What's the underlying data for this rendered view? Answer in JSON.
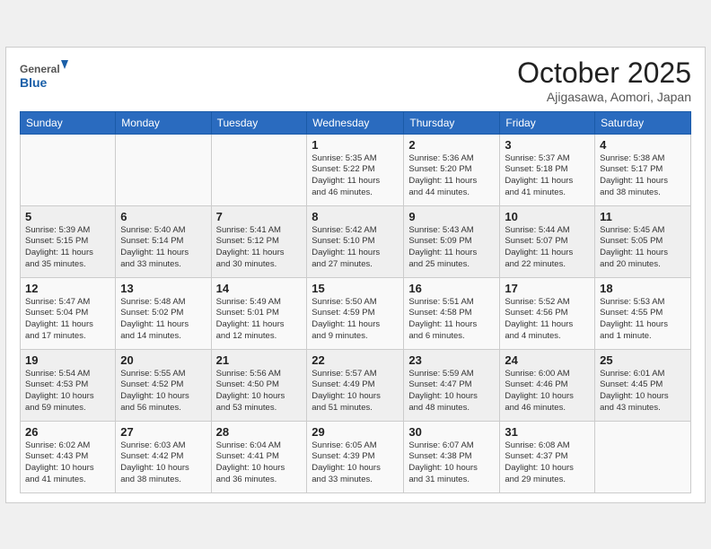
{
  "header": {
    "logo_line1": "General",
    "logo_line2": "Blue",
    "month": "October 2025",
    "location": "Ajigasawa, Aomori, Japan"
  },
  "weekdays": [
    "Sunday",
    "Monday",
    "Tuesday",
    "Wednesday",
    "Thursday",
    "Friday",
    "Saturday"
  ],
  "weeks": [
    [
      {
        "num": "",
        "info": ""
      },
      {
        "num": "",
        "info": ""
      },
      {
        "num": "",
        "info": ""
      },
      {
        "num": "1",
        "info": "Sunrise: 5:35 AM\nSunset: 5:22 PM\nDaylight: 11 hours\nand 46 minutes."
      },
      {
        "num": "2",
        "info": "Sunrise: 5:36 AM\nSunset: 5:20 PM\nDaylight: 11 hours\nand 44 minutes."
      },
      {
        "num": "3",
        "info": "Sunrise: 5:37 AM\nSunset: 5:18 PM\nDaylight: 11 hours\nand 41 minutes."
      },
      {
        "num": "4",
        "info": "Sunrise: 5:38 AM\nSunset: 5:17 PM\nDaylight: 11 hours\nand 38 minutes."
      }
    ],
    [
      {
        "num": "5",
        "info": "Sunrise: 5:39 AM\nSunset: 5:15 PM\nDaylight: 11 hours\nand 35 minutes."
      },
      {
        "num": "6",
        "info": "Sunrise: 5:40 AM\nSunset: 5:14 PM\nDaylight: 11 hours\nand 33 minutes."
      },
      {
        "num": "7",
        "info": "Sunrise: 5:41 AM\nSunset: 5:12 PM\nDaylight: 11 hours\nand 30 minutes."
      },
      {
        "num": "8",
        "info": "Sunrise: 5:42 AM\nSunset: 5:10 PM\nDaylight: 11 hours\nand 27 minutes."
      },
      {
        "num": "9",
        "info": "Sunrise: 5:43 AM\nSunset: 5:09 PM\nDaylight: 11 hours\nand 25 minutes."
      },
      {
        "num": "10",
        "info": "Sunrise: 5:44 AM\nSunset: 5:07 PM\nDaylight: 11 hours\nand 22 minutes."
      },
      {
        "num": "11",
        "info": "Sunrise: 5:45 AM\nSunset: 5:05 PM\nDaylight: 11 hours\nand 20 minutes."
      }
    ],
    [
      {
        "num": "12",
        "info": "Sunrise: 5:47 AM\nSunset: 5:04 PM\nDaylight: 11 hours\nand 17 minutes."
      },
      {
        "num": "13",
        "info": "Sunrise: 5:48 AM\nSunset: 5:02 PM\nDaylight: 11 hours\nand 14 minutes."
      },
      {
        "num": "14",
        "info": "Sunrise: 5:49 AM\nSunset: 5:01 PM\nDaylight: 11 hours\nand 12 minutes."
      },
      {
        "num": "15",
        "info": "Sunrise: 5:50 AM\nSunset: 4:59 PM\nDaylight: 11 hours\nand 9 minutes."
      },
      {
        "num": "16",
        "info": "Sunrise: 5:51 AM\nSunset: 4:58 PM\nDaylight: 11 hours\nand 6 minutes."
      },
      {
        "num": "17",
        "info": "Sunrise: 5:52 AM\nSunset: 4:56 PM\nDaylight: 11 hours\nand 4 minutes."
      },
      {
        "num": "18",
        "info": "Sunrise: 5:53 AM\nSunset: 4:55 PM\nDaylight: 11 hours\nand 1 minute."
      }
    ],
    [
      {
        "num": "19",
        "info": "Sunrise: 5:54 AM\nSunset: 4:53 PM\nDaylight: 10 hours\nand 59 minutes."
      },
      {
        "num": "20",
        "info": "Sunrise: 5:55 AM\nSunset: 4:52 PM\nDaylight: 10 hours\nand 56 minutes."
      },
      {
        "num": "21",
        "info": "Sunrise: 5:56 AM\nSunset: 4:50 PM\nDaylight: 10 hours\nand 53 minutes."
      },
      {
        "num": "22",
        "info": "Sunrise: 5:57 AM\nSunset: 4:49 PM\nDaylight: 10 hours\nand 51 minutes."
      },
      {
        "num": "23",
        "info": "Sunrise: 5:59 AM\nSunset: 4:47 PM\nDaylight: 10 hours\nand 48 minutes."
      },
      {
        "num": "24",
        "info": "Sunrise: 6:00 AM\nSunset: 4:46 PM\nDaylight: 10 hours\nand 46 minutes."
      },
      {
        "num": "25",
        "info": "Sunrise: 6:01 AM\nSunset: 4:45 PM\nDaylight: 10 hours\nand 43 minutes."
      }
    ],
    [
      {
        "num": "26",
        "info": "Sunrise: 6:02 AM\nSunset: 4:43 PM\nDaylight: 10 hours\nand 41 minutes."
      },
      {
        "num": "27",
        "info": "Sunrise: 6:03 AM\nSunset: 4:42 PM\nDaylight: 10 hours\nand 38 minutes."
      },
      {
        "num": "28",
        "info": "Sunrise: 6:04 AM\nSunset: 4:41 PM\nDaylight: 10 hours\nand 36 minutes."
      },
      {
        "num": "29",
        "info": "Sunrise: 6:05 AM\nSunset: 4:39 PM\nDaylight: 10 hours\nand 33 minutes."
      },
      {
        "num": "30",
        "info": "Sunrise: 6:07 AM\nSunset: 4:38 PM\nDaylight: 10 hours\nand 31 minutes."
      },
      {
        "num": "31",
        "info": "Sunrise: 6:08 AM\nSunset: 4:37 PM\nDaylight: 10 hours\nand 29 minutes."
      },
      {
        "num": "",
        "info": ""
      }
    ]
  ]
}
